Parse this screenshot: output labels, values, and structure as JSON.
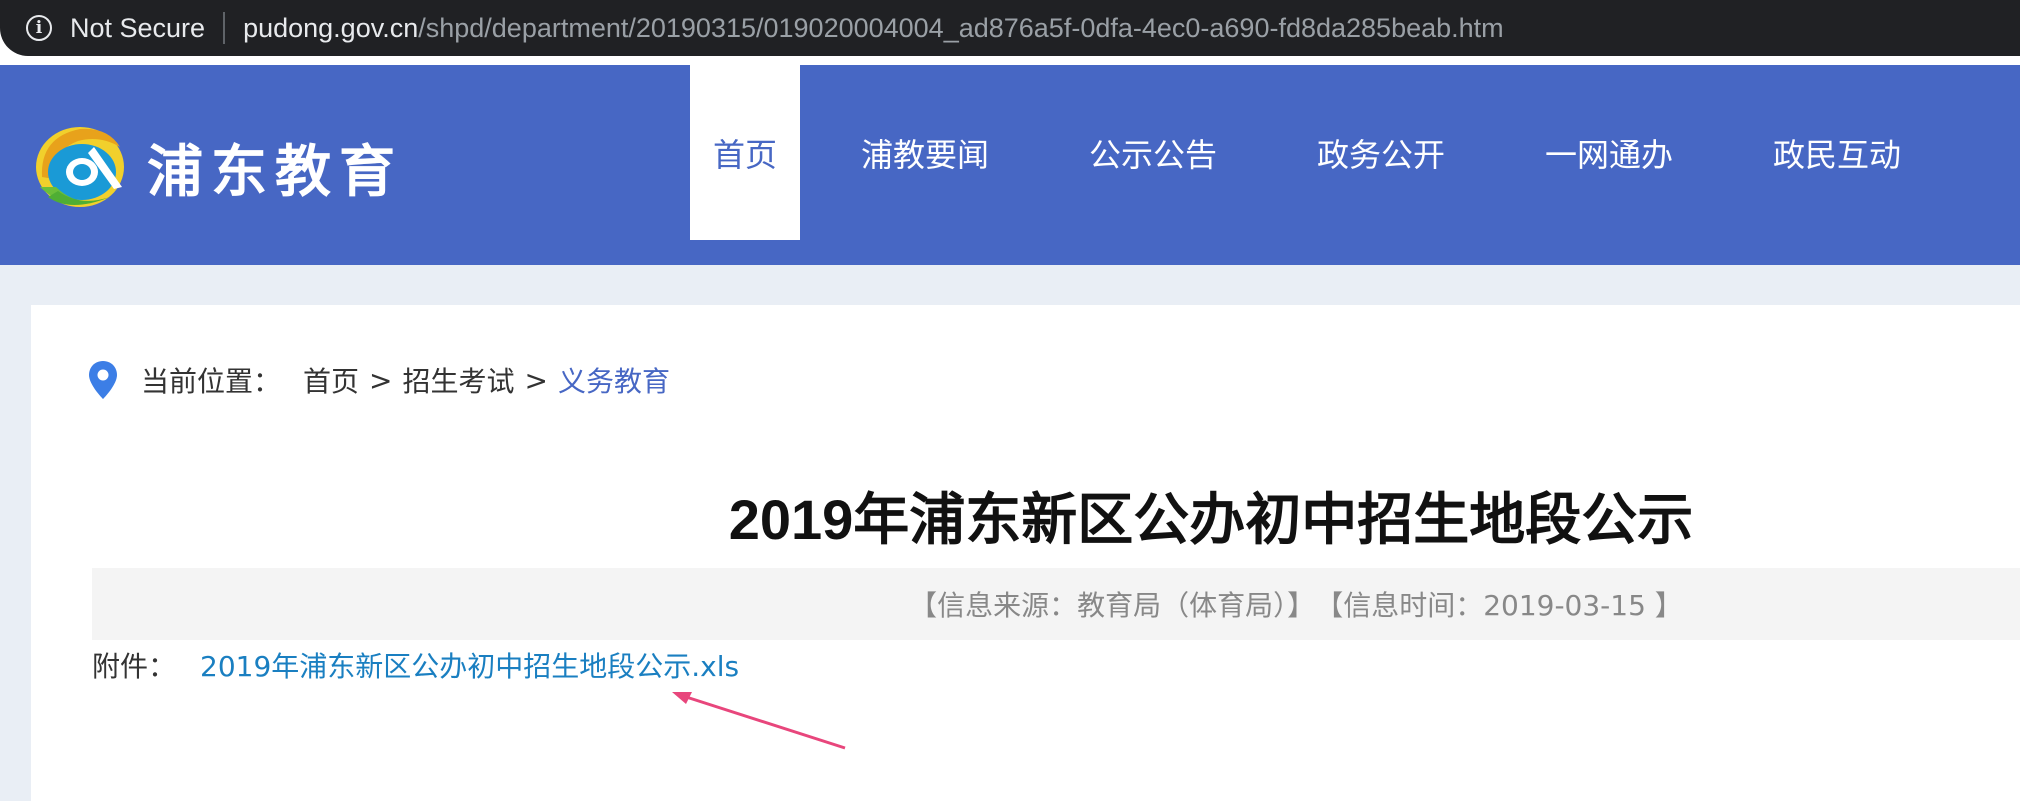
{
  "browser": {
    "security_label": "Not Secure",
    "url_host": "pudong.gov.cn",
    "url_path": "/shpd/department/20190315/019020004004_ad876a5f-0dfa-4ec0-a690-fd8da285beab.htm"
  },
  "header": {
    "site_name": "浦东教育",
    "nav": [
      {
        "label": "首页",
        "active": true
      },
      {
        "label": "浦教要闻"
      },
      {
        "label": "公示公告"
      },
      {
        "label": "政务公开"
      },
      {
        "label": "一网通办"
      },
      {
        "label": "政民互动"
      }
    ]
  },
  "breadcrumb": {
    "label": "当前位置：",
    "items": [
      "首页",
      "招生考试",
      "义务教育"
    ],
    "separator": ">"
  },
  "article": {
    "title": "2019年浦东新区公办初中招生地段公示",
    "source": "【信息来源：教育局（体育局）】",
    "time": "【信息时间：2019-03-15 】",
    "attachment_label": "附件：",
    "attachment_name": "2019年浦东新区公办初中招生地段公示.xls"
  },
  "colors": {
    "brand": "#4767c4",
    "link": "#1a7fc1",
    "annotation_arrow": "#e8467c"
  }
}
